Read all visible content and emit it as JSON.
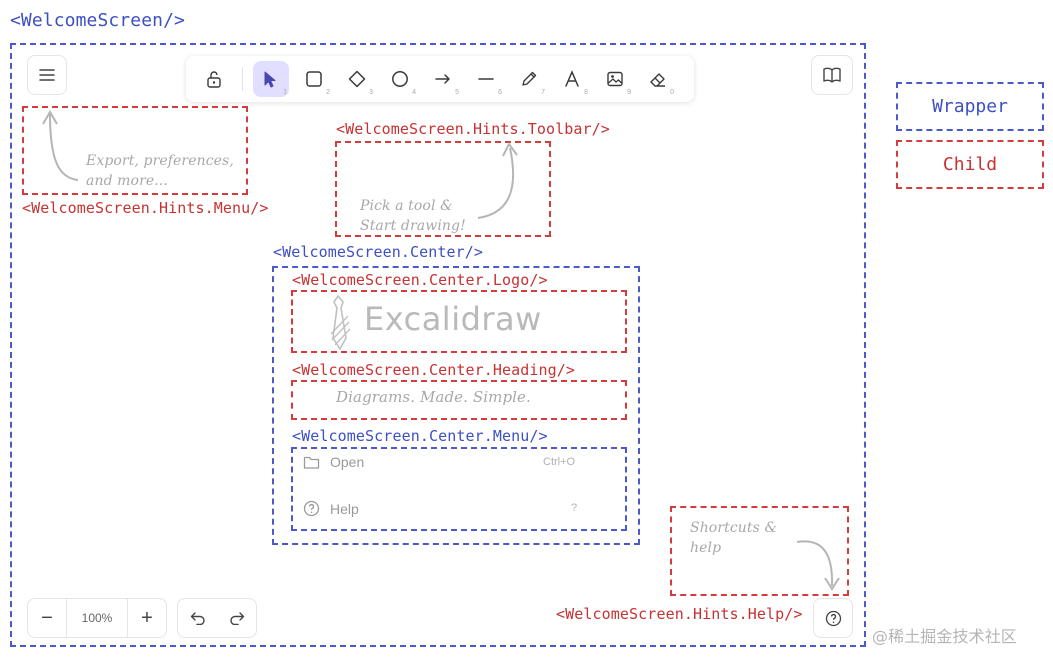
{
  "labels": {
    "welcome_screen": "<WelcomeScreen/>",
    "hints_menu": "<WelcomeScreen.Hints.Menu/>",
    "hints_toolbar": "<WelcomeScreen.Hints.Toolbar/>",
    "center": "<WelcomeScreen.Center/>",
    "center_logo": "<WelcomeScreen.Center.Logo/>",
    "center_heading": "<WelcomeScreen.Center.Heading/>",
    "center_menu": "<WelcomeScreen.Center.Menu/>",
    "hints_help": "<WelcomeScreen.Hints.Help/>"
  },
  "legend": {
    "wrapper": "Wrapper",
    "child": "Child"
  },
  "hints": {
    "menu_line1": "Export, preferences,",
    "menu_line2": "and more...",
    "toolbar_line1": "Pick a tool &",
    "toolbar_line2": "Start drawing!",
    "help_line1": "Shortcuts &",
    "help_line2": "help"
  },
  "logo_text": "Excalidraw",
  "heading_text": "Diagrams. Made. Simple.",
  "center_menu": [
    {
      "label": "Open",
      "shortcut": "Ctrl+O",
      "icon": "folder-icon"
    },
    {
      "label": "Help",
      "shortcut": "?",
      "icon": "help-circle-icon"
    }
  ],
  "toolbar": {
    "tools": [
      {
        "name": "selection",
        "key": "1",
        "icon": "pointer-icon",
        "active": true
      },
      {
        "name": "rectangle",
        "key": "2",
        "icon": "rectangle-icon"
      },
      {
        "name": "diamond",
        "key": "3",
        "icon": "diamond-icon"
      },
      {
        "name": "ellipse",
        "key": "4",
        "icon": "ellipse-icon"
      },
      {
        "name": "arrow",
        "key": "5",
        "icon": "arrow-icon"
      },
      {
        "name": "line",
        "key": "6",
        "icon": "line-icon"
      },
      {
        "name": "draw",
        "key": "7",
        "icon": "pencil-icon"
      },
      {
        "name": "text",
        "key": "8",
        "icon": "text-icon"
      },
      {
        "name": "image",
        "key": "9",
        "icon": "image-icon"
      },
      {
        "name": "eraser",
        "key": "0",
        "icon": "eraser-icon"
      }
    ]
  },
  "zoom": {
    "level": "100%",
    "minus": "−",
    "plus": "+"
  },
  "watermark": "@稀土掘金技术社区",
  "colors": {
    "wrapper": "#4a5bc8",
    "child": "#d33d3d",
    "active_tool": "#e0dfff"
  }
}
